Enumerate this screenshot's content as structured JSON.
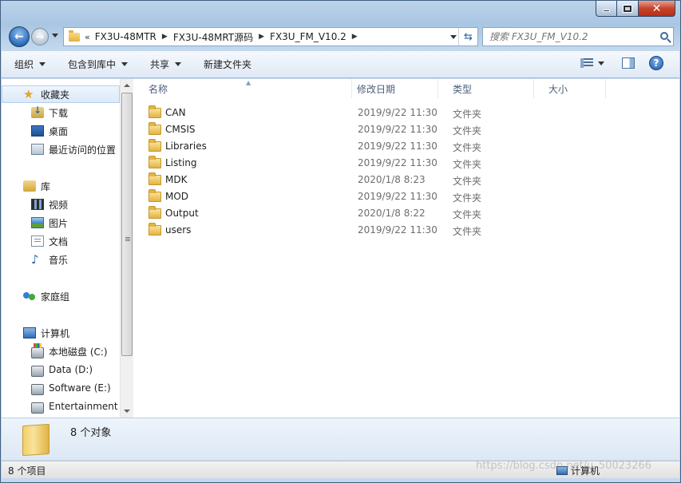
{
  "address": {
    "crumbs": [
      "FX3U-48MTR",
      "FX3U-48MRT源码",
      "FX3U_FM_V10.2"
    ],
    "chevron": "«"
  },
  "search": {
    "placeholder": "搜索 FX3U_FM_V10.2"
  },
  "toolbar": {
    "organize": "组织",
    "include_in_library": "包含到库中",
    "share": "共享",
    "new_folder": "新建文件夹"
  },
  "nav": {
    "favorites": {
      "label": "收藏夹",
      "items": [
        "下载",
        "桌面",
        "最近访问的位置"
      ]
    },
    "libraries": {
      "label": "库",
      "items": [
        "视频",
        "图片",
        "文档",
        "音乐"
      ]
    },
    "homegroup": {
      "label": "家庭组"
    },
    "computer": {
      "label": "计算机",
      "items": [
        "本地磁盘 (C:)",
        "Data (D:)",
        "Software (E:)",
        "Entertainment ("
      ]
    }
  },
  "columns": {
    "name": "名称",
    "modified": "修改日期",
    "type": "类型",
    "size": "大小"
  },
  "files": [
    {
      "name": "CAN",
      "date": "2019/9/22 11:30",
      "type": "文件夹"
    },
    {
      "name": "CMSIS",
      "date": "2019/9/22 11:30",
      "type": "文件夹"
    },
    {
      "name": "Libraries",
      "date": "2019/9/22 11:30",
      "type": "文件夹"
    },
    {
      "name": "Listing",
      "date": "2019/9/22 11:30",
      "type": "文件夹"
    },
    {
      "name": "MDK",
      "date": "2020/1/8 8:23",
      "type": "文件夹"
    },
    {
      "name": "MOD",
      "date": "2019/9/22 11:30",
      "type": "文件夹"
    },
    {
      "name": "Output",
      "date": "2020/1/8 8:22",
      "type": "文件夹"
    },
    {
      "name": "users",
      "date": "2019/9/22 11:30",
      "type": "文件夹"
    }
  ],
  "details": {
    "count_text": "8 个对象"
  },
  "status": {
    "items_text": "8 个项目",
    "location": "计算机"
  },
  "watermark": "https://blog.csdn.net/u_50023266"
}
